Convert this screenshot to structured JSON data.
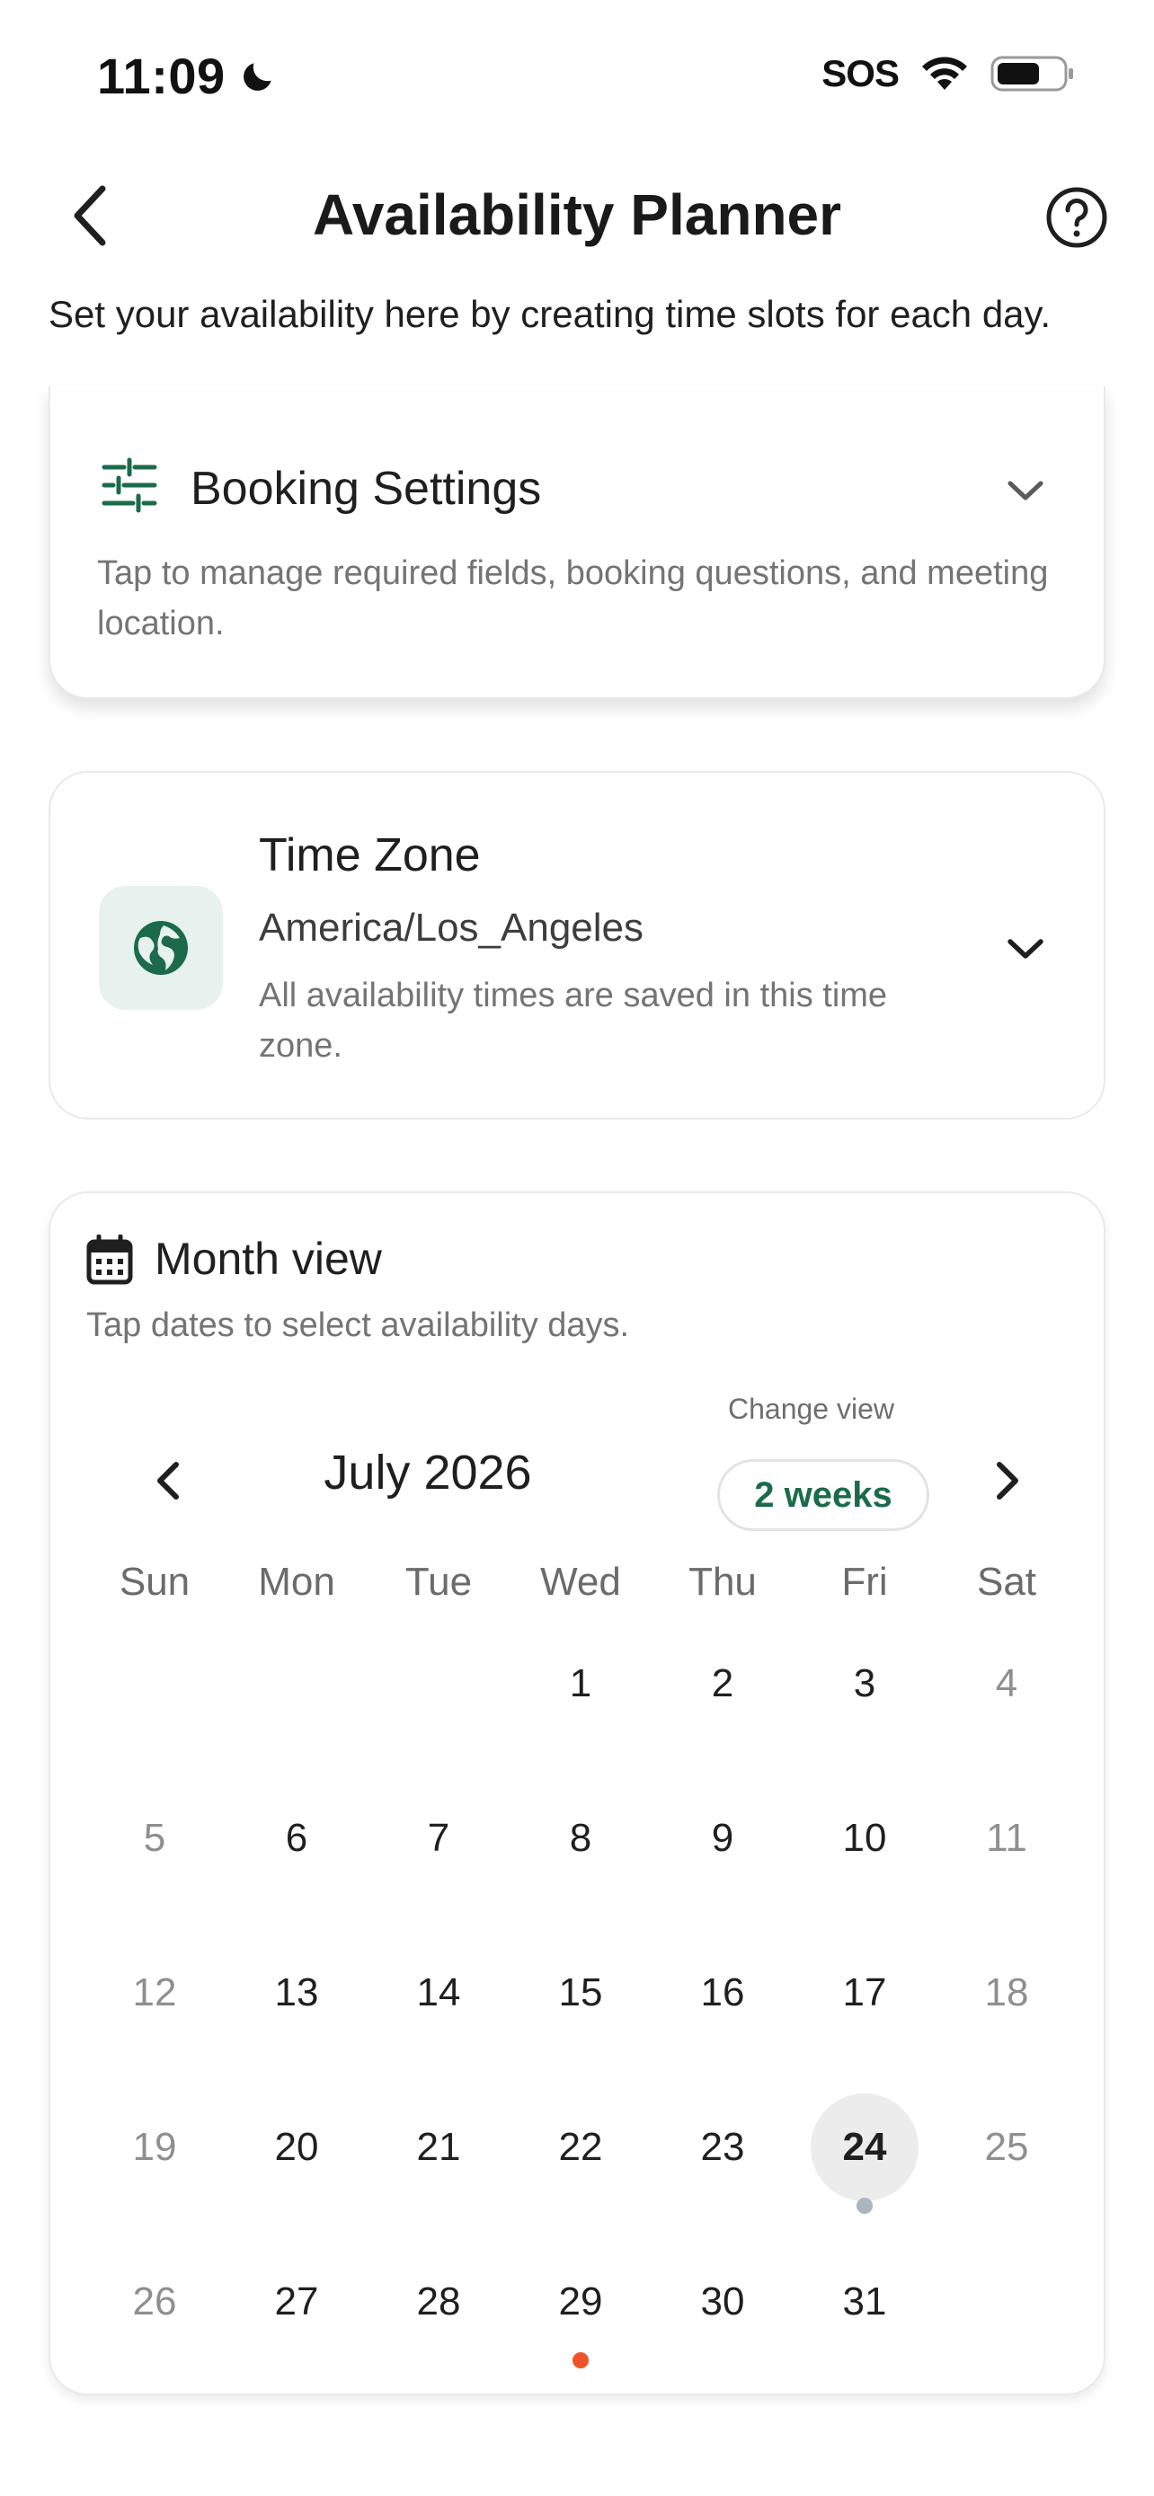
{
  "status_bar": {
    "time": "11:09",
    "carrier": "SOS"
  },
  "header": {
    "title": "Availability Planner"
  },
  "intro": "Set your availability here by creating time slots for each day.",
  "booking_settings": {
    "title": "Booking Settings",
    "description": "Tap to manage required fields, booking questions, and meeting location."
  },
  "time_zone": {
    "title": "Time Zone",
    "value": "America/Los_Angeles",
    "description": "All availability times are saved in this time zone."
  },
  "month_view": {
    "title": "Month view",
    "description": "Tap dates to select availability days.",
    "change_view_label": "Change view",
    "view_option": "2 weeks",
    "month_label": "July 2026",
    "weekdays": [
      "Sun",
      "Mon",
      "Tue",
      "Wed",
      "Thu",
      "Fri",
      "Sat"
    ],
    "weeks": [
      [
        "",
        "",
        "",
        "1",
        "2",
        "3",
        "4"
      ],
      [
        "5",
        "6",
        "7",
        "8",
        "9",
        "10",
        "11"
      ],
      [
        "12",
        "13",
        "14",
        "15",
        "16",
        "17",
        "18"
      ],
      [
        "19",
        "20",
        "21",
        "22",
        "23",
        "24",
        "25"
      ],
      [
        "26",
        "27",
        "28",
        "29",
        "30",
        "31",
        ""
      ]
    ],
    "selected_day": "24",
    "markers": [
      {
        "day": "24",
        "color": "#a9b6bf"
      },
      {
        "day": "29",
        "color": "#f0532b"
      }
    ]
  },
  "colors": {
    "accent": "#1b6b4a",
    "accent_bg": "#e7f2ee"
  }
}
